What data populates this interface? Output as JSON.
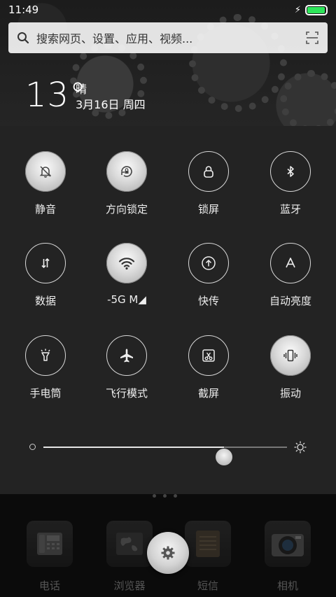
{
  "status_bar": {
    "time": "11:49",
    "battery_percent": 0.95,
    "battery_color": "#2ee65a",
    "charging_icon": "lightning-icon"
  },
  "search": {
    "placeholder": "搜索网页、设置、应用、视频...",
    "search_icon": "search-icon",
    "scan_icon": "scan-icon"
  },
  "weather": {
    "temperature": "13°",
    "condition": "晴",
    "date": "3月16日 周四"
  },
  "toggles": [
    {
      "label": "静音",
      "icon": "bell-off-icon",
      "on": true
    },
    {
      "label": "方向锁定",
      "icon": "rotation-lock-icon",
      "on": true
    },
    {
      "label": "锁屏",
      "icon": "lock-icon",
      "on": false
    },
    {
      "label": "蓝牙",
      "icon": "bluetooth-icon",
      "on": false
    },
    {
      "label": "数据",
      "icon": "data-arrows-icon",
      "on": false
    },
    {
      "label": "-5G M◢",
      "icon": "wifi-icon",
      "on": true
    },
    {
      "label": "快传",
      "icon": "upload-icon",
      "on": false
    },
    {
      "label": "自动亮度",
      "icon": "auto-brightness-icon",
      "on": false
    },
    {
      "label": "手电筒",
      "icon": "flashlight-icon",
      "on": false
    },
    {
      "label": "飞行模式",
      "icon": "airplane-icon",
      "on": false
    },
    {
      "label": "截屏",
      "icon": "screenshot-icon",
      "on": false
    },
    {
      "label": "振动",
      "icon": "vibrate-icon",
      "on": true
    }
  ],
  "brightness": {
    "level": 0.74
  },
  "dock": {
    "apps": [
      {
        "label": "电话",
        "icon": "phone-icon"
      },
      {
        "label": "浏览器",
        "icon": "browser-globe-icon"
      },
      {
        "label": "短信",
        "icon": "messages-icon"
      },
      {
        "label": "相机",
        "icon": "camera-icon"
      }
    ],
    "settings_icon": "gear-icon"
  }
}
